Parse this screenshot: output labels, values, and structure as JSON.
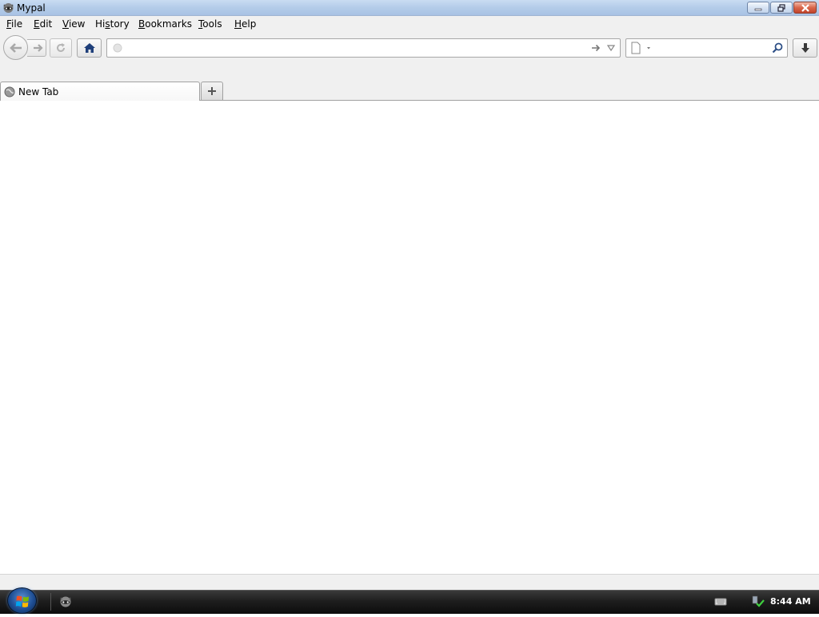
{
  "window": {
    "title": "Mypal"
  },
  "menubar": {
    "items": [
      {
        "mnemonic": "F",
        "rest": "ile"
      },
      {
        "mnemonic": "E",
        "rest": "dit"
      },
      {
        "mnemonic": "V",
        "rest": "iew"
      },
      {
        "pre": "Hi",
        "mnemonic": "s",
        "rest": "tory"
      },
      {
        "mnemonic": "B",
        "rest": "ookmarks"
      },
      {
        "mnemonic": "T",
        "rest": "ools"
      },
      {
        "mnemonic": "H",
        "rest": "elp"
      }
    ]
  },
  "urlbar": {
    "value": "",
    "placeholder": ""
  },
  "searchbar": {
    "value": "",
    "placeholder": ""
  },
  "tabs": [
    {
      "label": "New Tab",
      "active": true
    }
  ],
  "taskbar": {
    "clock": "8:44 AM"
  },
  "colors": {
    "titlebar": "#b4cce9",
    "chrome": "#f0f0f0",
    "home_icon": "#1f3f7a",
    "taskbar": "#1e1e1e"
  },
  "icons": {
    "app": "raccoon-icon",
    "back": "back-arrow-icon",
    "forward": "forward-arrow-icon",
    "reload": "reload-icon",
    "home": "home-icon",
    "download": "download-arrow-icon",
    "search": "magnifier-icon"
  }
}
